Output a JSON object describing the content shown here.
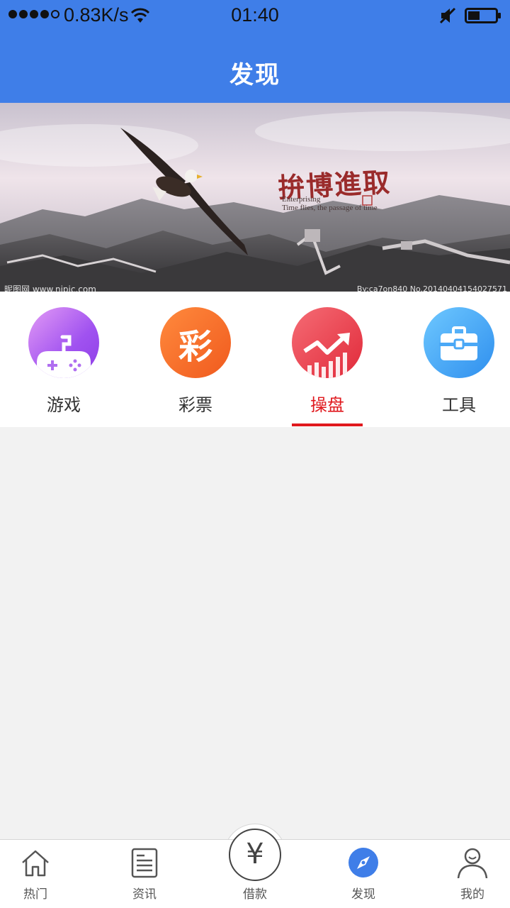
{
  "status_bar": {
    "net_speed": "0.83K/s",
    "time": "01:40"
  },
  "header": {
    "title": "发现"
  },
  "banner": {
    "caption": "拚博進取",
    "subtitle_line1": "Enterprising",
    "subtitle_line2": "Time flies, the passage of time",
    "watermark_left": "昵图网 www.nipic.com",
    "watermark_right": "By:ca7on840 No.20140404154027571"
  },
  "categories": [
    {
      "label": "游戏",
      "icon": "gamepad-icon"
    },
    {
      "label": "彩票",
      "icon": "lottery-icon",
      "glyph": "彩"
    },
    {
      "label": "操盘",
      "icon": "trend-chart-icon",
      "active": true
    },
    {
      "label": "工具",
      "icon": "toolbox-icon"
    }
  ],
  "tabbar": {
    "items": [
      {
        "label": "热门",
        "icon": "home-icon"
      },
      {
        "label": "资讯",
        "icon": "news-icon"
      },
      {
        "label": "借款",
        "icon": "yen-icon",
        "glyph": "¥"
      },
      {
        "label": "发现",
        "icon": "compass-icon",
        "active": true
      },
      {
        "label": "我的",
        "icon": "user-icon"
      }
    ]
  },
  "colors": {
    "primary": "#3f7ee8",
    "active_red": "#e0191e",
    "background": "#f2f2f2"
  }
}
